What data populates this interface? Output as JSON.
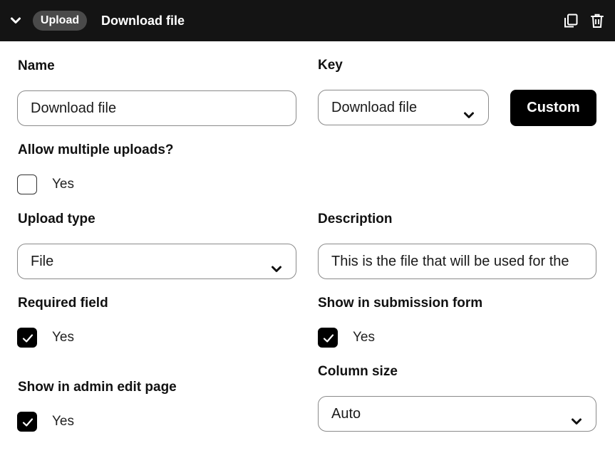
{
  "header": {
    "badge": "Upload",
    "title": "Download file",
    "icons": [
      "chevron-down-icon",
      "copy-icon",
      "trash-icon"
    ]
  },
  "name": {
    "label": "Name",
    "value": "Download file"
  },
  "key": {
    "label": "Key",
    "value": "Download file",
    "custom_button": "Custom"
  },
  "allow_multiple": {
    "label": "Allow multiple uploads?",
    "option": "Yes",
    "checked": false
  },
  "upload_type": {
    "label": "Upload type",
    "value": "File"
  },
  "description": {
    "label": "Description",
    "value": "This is the file that will be used for the"
  },
  "required_field": {
    "label": "Required field",
    "option": "Yes",
    "checked": true
  },
  "show_in_submission": {
    "label": "Show in submission form",
    "option": "Yes",
    "checked": true
  },
  "show_in_admin": {
    "label": "Show in admin edit page",
    "option": "Yes",
    "checked": true
  },
  "column_size": {
    "label": "Column size",
    "value": "Auto"
  },
  "colors": {
    "header_bg": "#141414",
    "badge_bg": "#4a4a4a",
    "primary": "#000000",
    "border": "#8a8a8a"
  }
}
